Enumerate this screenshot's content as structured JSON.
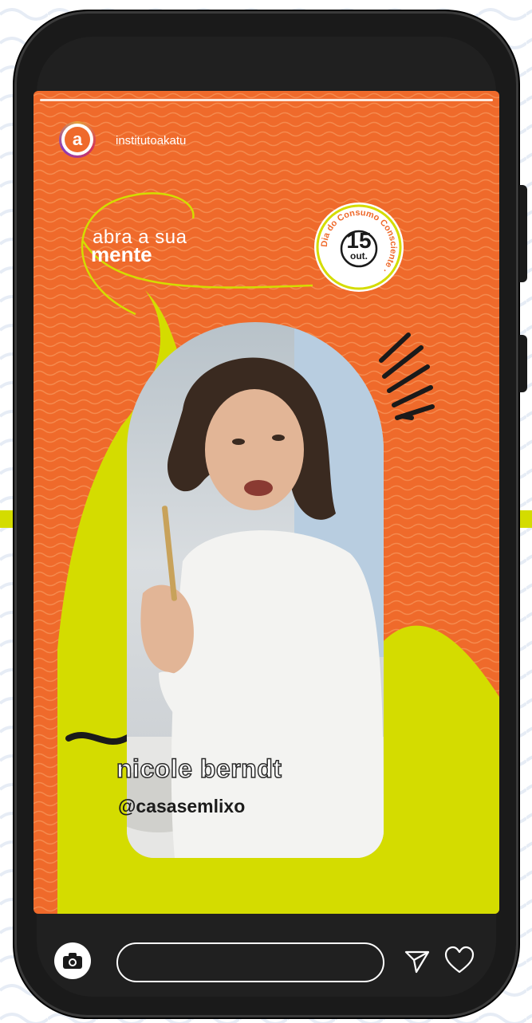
{
  "story": {
    "username": "institutoakatu",
    "avatar_letter": "a",
    "brand_line1": "abra a sua",
    "brand_line2": "mente",
    "badge": {
      "ring_text": "Dia do Consumo Consciente ·",
      "day": "15",
      "month": "out."
    },
    "person_name": "nicole berndt",
    "person_handle": "@casasemlixo"
  },
  "reply_bar": {
    "camera_icon": "camera-icon",
    "input_placeholder": "",
    "send_icon": "send-icon",
    "like_icon": "heart-icon"
  },
  "colors": {
    "story_orange": "#ef6a2b",
    "lime": "#d4dc00",
    "phone_body": "#1a1a1a"
  }
}
